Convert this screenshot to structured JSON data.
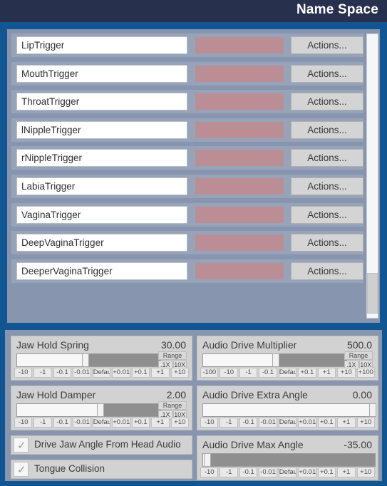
{
  "window": {
    "title": "Name Space"
  },
  "list_panel": {
    "action_label": "Actions...",
    "rows": [
      {
        "name": "LipTrigger"
      },
      {
        "name": "MouthTrigger"
      },
      {
        "name": "ThroatTrigger"
      },
      {
        "name": "lNippleTrigger"
      },
      {
        "name": "rNippleTrigger"
      },
      {
        "name": "LabiaTrigger"
      },
      {
        "name": "VaginaTrigger"
      },
      {
        "name": "DeepVaginaTrigger"
      },
      {
        "name": "DeeperVaginaTrigger"
      }
    ],
    "swatch_color": "#bb8e96",
    "scrollbar": {
      "thumb_position_percent": 84
    }
  },
  "controls": {
    "range_label": "Range",
    "range_buttons": [
      ".1X",
      "10X"
    ],
    "left_column": {
      "sliders": [
        {
          "label": "Jaw Hold Spring",
          "value": "30.00",
          "fill_percent": 46,
          "has_range": true,
          "steppers": [
            "-10",
            "-1",
            "-0.1",
            "-0.01",
            "Default",
            "+0.01",
            "+0.1",
            "+1",
            "+10"
          ]
        },
        {
          "label": "Jaw Hold Damper",
          "value": "2.00",
          "fill_percent": 56,
          "has_range": true,
          "steppers": [
            "-10",
            "-1",
            "-0.1",
            "-0.01",
            "Default",
            "+0.01",
            "+0.1",
            "+1",
            "+10"
          ]
        }
      ],
      "checkboxes": [
        {
          "label": "Drive Jaw Angle From Head Audio",
          "checked": true,
          "mark": "✓"
        },
        {
          "label": "Tongue Collision",
          "checked": true,
          "mark": "✓"
        }
      ]
    },
    "right_column": {
      "sliders": [
        {
          "label": "Audio Drive Multiplier",
          "value": "500.0",
          "fill_percent": 49,
          "has_range": true,
          "steppers": [
            "-100",
            "-10",
            "-1",
            "-0.1",
            "Default",
            "+0.1",
            "+1",
            "+10",
            "+100"
          ]
        },
        {
          "label": "Audio Drive Extra Angle",
          "value": "0.00",
          "fill_percent": 97,
          "has_range": false,
          "steppers": [
            "-10",
            "-1",
            "-0.1",
            "-0.01",
            "Default",
            "+0.01",
            "+0.1",
            "+1",
            "+10"
          ]
        },
        {
          "label": "Audio Drive Max Angle",
          "value": "-35.00",
          "fill_percent": 1,
          "has_range": false,
          "steppers": [
            "-10",
            "-1",
            "-0.1",
            "-0.01",
            "Default",
            "+0.01",
            "+0.1",
            "+1",
            "+10"
          ]
        }
      ]
    }
  },
  "colors": {
    "titlebar": "#27304d",
    "window_background": "#115693",
    "panel": "#8795ae",
    "card": "#d2d2d2",
    "swatch": "#bb8e96"
  }
}
